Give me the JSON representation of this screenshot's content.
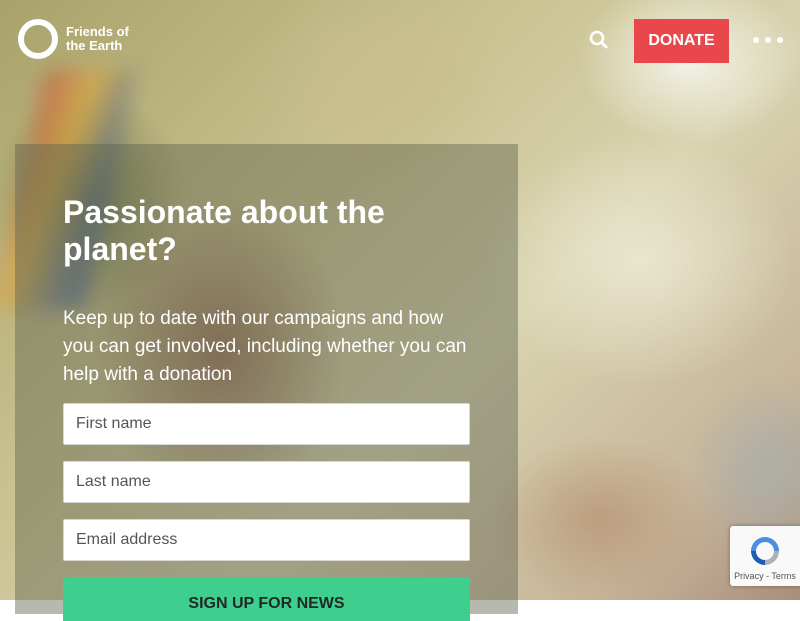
{
  "header": {
    "logo_line1": "Friends of",
    "logo_line2": "the Earth",
    "search_icon": "search-icon",
    "donate_label": "DONATE",
    "menu_icon": "more-dots-icon",
    "donate_color": "#e8484c"
  },
  "signup": {
    "heading": "Passionate about the planet?",
    "description": "Keep up to date with our campaigns and how you can get involved, including whether you can help with a donation",
    "first_name_placeholder": "First name",
    "last_name_placeholder": "Last name",
    "email_placeholder": "Email address",
    "submit_label": "SIGN UP FOR NEWS",
    "submit_color": "#3ecf8e"
  },
  "recaptcha": {
    "privacy": "Privacy",
    "separator": " - ",
    "terms": "Terms"
  }
}
